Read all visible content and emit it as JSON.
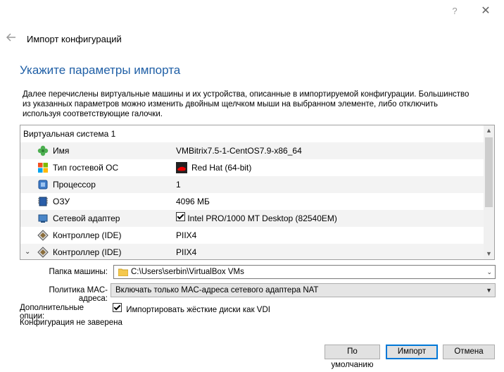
{
  "titlebar": {
    "help_glyph": "?",
    "close_glyph": "✕"
  },
  "wizard": {
    "name": "Импорт конфигураций",
    "heading": "Укажите параметры импорта"
  },
  "description": "Далее перечислены виртуальные машины и их устройства, описанные в импортируемой конфигурации. Большинство из указанных параметров можно изменить двойным щелчком мыши на выбранном элементе, либо отключить используя соответствующие галочки.",
  "tree": {
    "group_label": "Виртуальная система 1",
    "rows": [
      {
        "icon": "name-icon",
        "name": "Имя",
        "value": "VMBitrix7.5-1-CentOS7.9-x86_64"
      },
      {
        "icon": "os-type-icon",
        "name": "Тип гостевой ОС",
        "value": "Red Hat (64-bit)",
        "value_icon": "redhat-icon"
      },
      {
        "icon": "processor-icon",
        "name": "Процессор",
        "value": "1"
      },
      {
        "icon": "ram-icon",
        "name": "ОЗУ",
        "value": "4096 МБ"
      },
      {
        "icon": "network-adapter-icon",
        "name": "Сетевой адаптер",
        "value": "Intel PRO/1000 MT Desktop (82540EM)",
        "checked": true
      },
      {
        "icon": "ide-controller-icon",
        "name": "Контроллер (IDE)",
        "value": "PIIX4"
      },
      {
        "icon": "ide-controller-icon",
        "name": "Контроллер (IDE)",
        "value": "PIIX4",
        "expanded": true
      }
    ]
  },
  "machine_folder": {
    "label": "Папка машины:",
    "value": "C:\\Users\\serbin\\VirtualBox VMs"
  },
  "mac_policy": {
    "label": "Политика MAC-адреса:",
    "value": "Включать только MAC-адреса сетевого адаптера NAT"
  },
  "extra_options": {
    "label": "Дополнительные опции:",
    "checkbox_label": "Импортировать жёсткие диски как VDI",
    "checked": true
  },
  "status_text": "Конфигурация не заверена",
  "buttons": {
    "defaults": "По умолчанию",
    "import": "Импорт",
    "cancel": "Отмена"
  },
  "colors": {
    "heading": "#1f5fa6",
    "default_button_border": "#0078d7"
  }
}
